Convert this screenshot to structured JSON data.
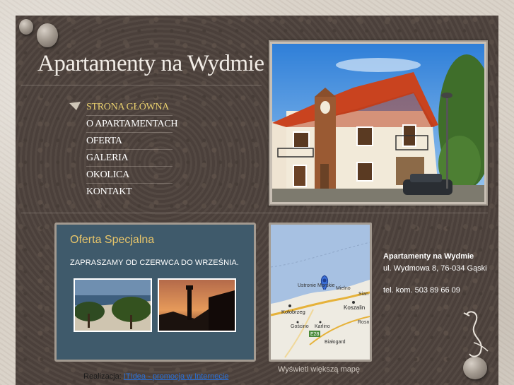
{
  "header": {
    "title": "Apartamenty na Wydmie"
  },
  "nav": {
    "items": [
      {
        "label": "STRONA GŁÓWNA",
        "active": true
      },
      {
        "label": "O APARTAMENTACH",
        "active": false
      },
      {
        "label": "OFERTA",
        "active": false
      },
      {
        "label": "GALERIA",
        "active": false
      },
      {
        "label": "OKOLICA",
        "active": false
      },
      {
        "label": "KONTAKT",
        "active": false
      }
    ]
  },
  "offer": {
    "title": "Oferta Specjalna",
    "text": "ZAPRASZAMY OD CZERWCA DO WRZEŚNIA."
  },
  "map": {
    "link_label": "Wyświetl większą mapę",
    "places": [
      "Ustronie Morskie",
      "Mielno",
      "Sian",
      "Kołobrzeg",
      "Koszalin",
      "Gościno",
      "Karlino",
      "Rosn",
      "Białogard"
    ],
    "road": "E28"
  },
  "contact": {
    "name": "Apartamenty na Wydmie",
    "address": "ul. Wydmowa 8, 76-034 Gąski",
    "phone": "tel. kom. 503 89 66 09"
  },
  "footer": {
    "prefix": "Realizacja: ",
    "link": "ITIdea - promocja w Internecie"
  },
  "colors": {
    "panel": "#4e433d",
    "accent_gold": "#e6c46a",
    "offer_bg": "#3f5a6b",
    "link_blue": "#2a6fd6"
  }
}
